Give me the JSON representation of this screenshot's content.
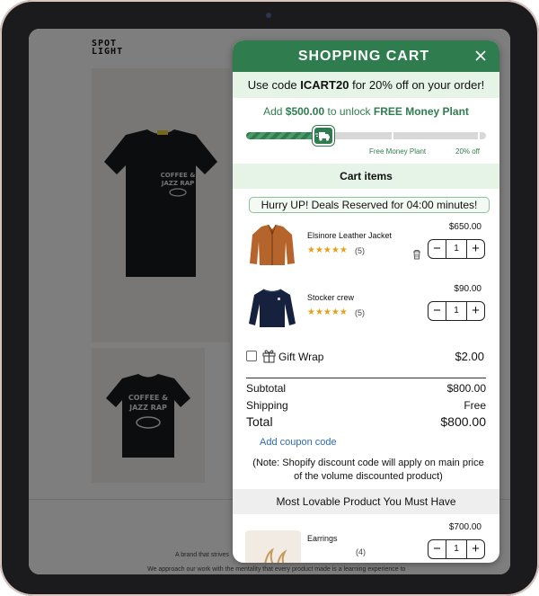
{
  "store": {
    "logo_line1": "SPOT",
    "logo_line2": "LIGHT",
    "footer_line1": "A brand that strives",
    "footer_line2": "We approach our work with the mentality that every product made is a learning experience to"
  },
  "cart": {
    "title": "SHOPPING CART",
    "promo": {
      "prefix": "Use code ",
      "code": "ICART20",
      "suffix": " for 20% off on your order!"
    },
    "unlock": {
      "prefix": "Add ",
      "amount": "$500.00",
      "middle": " to unlock ",
      "reward": "FREE Money Plant"
    },
    "progress": {
      "fraction": 0.32,
      "milestone_1": "Free Money Plant",
      "milestone_2": "20% off"
    },
    "items_heading": "Cart items",
    "hurry_text": "Hurry UP! Deals Reserved for 04:00 minutes!",
    "items": [
      {
        "name": "Elsinore Leather Jacket",
        "stars": "★★★★★",
        "reviews": "(5)",
        "price": "$650.00",
        "qty": "1"
      },
      {
        "name": "Stocker crew",
        "stars": "★★★★★",
        "reviews": "(5)",
        "price": "$90.00",
        "qty": "1"
      }
    ],
    "gift_wrap": {
      "label": "Gift Wrap",
      "price": "$2.00",
      "checked": false
    },
    "summary": {
      "subtotal_label": "Subtotal",
      "subtotal_value": "$800.00",
      "shipping_label": "Shipping",
      "shipping_value": "Free",
      "total_label": "Total",
      "total_value": "$800.00"
    },
    "coupon_link": "Add coupon code",
    "note": "(Note: Shopify discount code will apply on main price of the volume discounted product)",
    "recommend_heading": "Most Lovable Product You Must Have",
    "recommended": {
      "name": "Earrings",
      "reviews": "(4)",
      "price": "$700.00",
      "qty": "1"
    }
  },
  "colors": {
    "accent": "#2f7d4f",
    "light_accent": "#e6f3e7",
    "link": "#2a6bb5",
    "stars": "#e4a017"
  }
}
